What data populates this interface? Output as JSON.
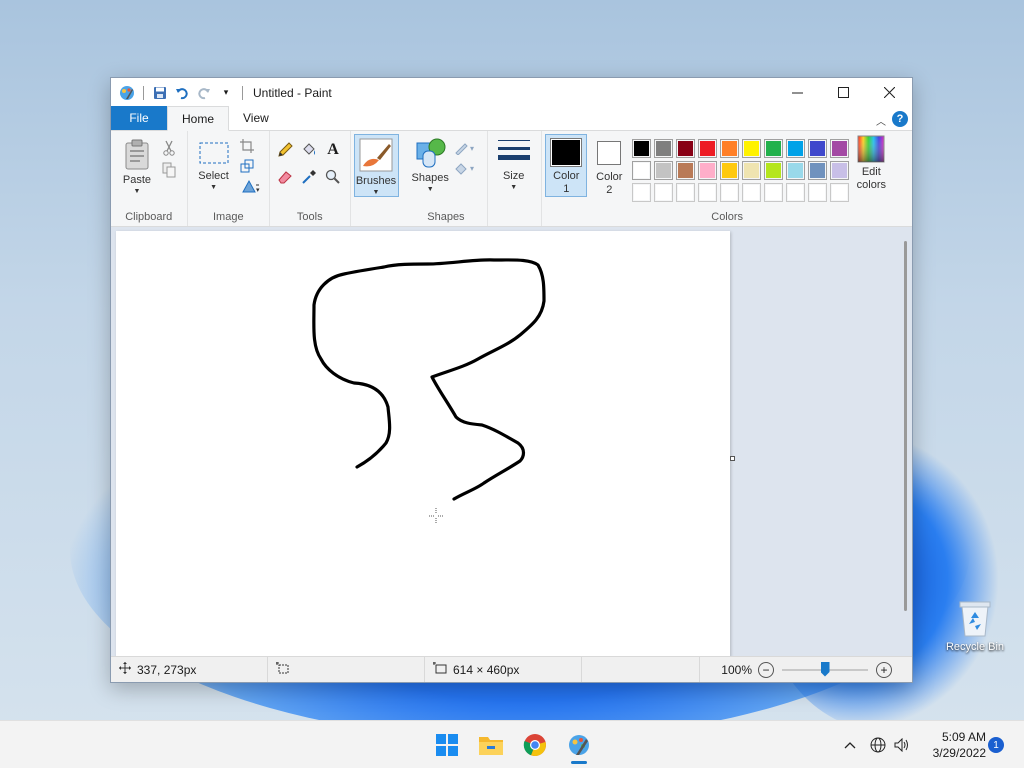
{
  "window": {
    "title": "Untitled - Paint"
  },
  "tabs": [
    {
      "label": "File"
    },
    {
      "label": "Home"
    },
    {
      "label": "View"
    }
  ],
  "ribbon": {
    "clipboard": {
      "label": "Clipboard",
      "paste": "Paste"
    },
    "image": {
      "label": "Image",
      "select": "Select"
    },
    "tools": {
      "label": "Tools"
    },
    "brushes": {
      "label": "Brushes"
    },
    "shapes": {
      "label": "Shapes",
      "button": "Shapes"
    },
    "size": {
      "label": "Size"
    },
    "colors": {
      "label": "Colors",
      "color1": "Color\n1",
      "color2": "Color\n2",
      "edit": "Edit colors",
      "color1_value": "#000000",
      "color2_value": "#ffffff",
      "palette_row1": [
        "#000000",
        "#7f7f7f",
        "#880015",
        "#ed1c24",
        "#ff7f27",
        "#fff200",
        "#22b14c",
        "#00a2e8",
        "#3f48cc",
        "#a349a4"
      ],
      "palette_row2": [
        "#ffffff",
        "#c3c3c3",
        "#b97a57",
        "#ffaec9",
        "#ffc90e",
        "#efe4b0",
        "#b5e61d",
        "#99d9ea",
        "#7092be",
        "#c8bfe7"
      ],
      "palette_row3": [
        "#ffffff",
        "#ffffff",
        "#ffffff",
        "#ffffff",
        "#ffffff",
        "#ffffff",
        "#ffffff",
        "#ffffff",
        "#ffffff",
        "#ffffff"
      ]
    }
  },
  "status": {
    "cursor_pos": "337, 273px",
    "canvas_size": "614 × 460px",
    "zoom": "100%",
    "zoom_level": 100
  },
  "desktop": {
    "recycle_bin": "Recycle Bin"
  },
  "taskbar": {
    "time": "5:09 AM",
    "date": "3/29/2022",
    "notifications": "1"
  }
}
